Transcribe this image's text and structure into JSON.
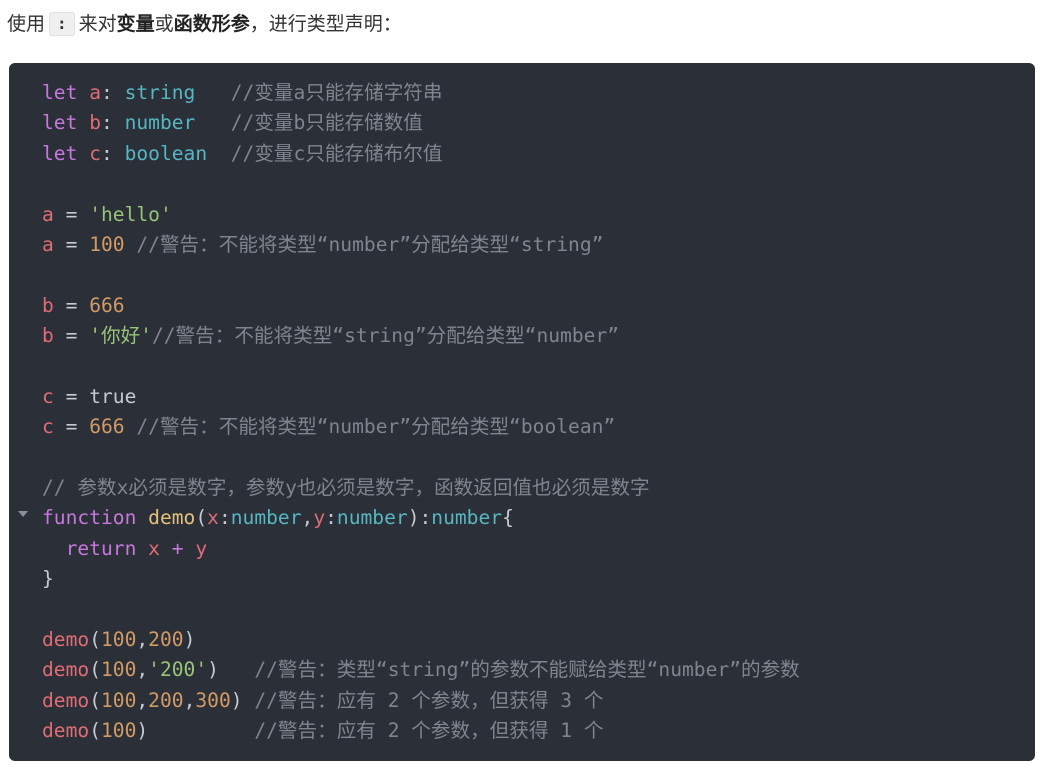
{
  "intro": {
    "prefix": "使用",
    "inline_code": ":",
    "middle": "来对",
    "bold1": "变量",
    "or": "或",
    "bold2": "函数形参",
    "suffix": "，进行类型声明："
  },
  "code": {
    "lines": [
      [
        [
          "kw",
          "let"
        ],
        [
          "pun",
          " "
        ],
        [
          "var",
          "a"
        ],
        [
          "pun",
          ": "
        ],
        [
          "type",
          "string"
        ],
        [
          "pun",
          "   "
        ],
        [
          "cmt",
          "//变量a只能存储字符串"
        ]
      ],
      [
        [
          "kw",
          "let"
        ],
        [
          "pun",
          " "
        ],
        [
          "var",
          "b"
        ],
        [
          "pun",
          ": "
        ],
        [
          "type",
          "number"
        ],
        [
          "pun",
          "   "
        ],
        [
          "cmt",
          "//变量b只能存储数值"
        ]
      ],
      [
        [
          "kw",
          "let"
        ],
        [
          "pun",
          " "
        ],
        [
          "var",
          "c"
        ],
        [
          "pun",
          ": "
        ],
        [
          "type",
          "boolean"
        ],
        [
          "pun",
          "  "
        ],
        [
          "cmt",
          "//变量c只能存储布尔值"
        ]
      ],
      [],
      [
        [
          "var",
          "a"
        ],
        [
          "pun",
          " = "
        ],
        [
          "str",
          "'hello'"
        ]
      ],
      [
        [
          "var",
          "a"
        ],
        [
          "pun",
          " = "
        ],
        [
          "num",
          "100"
        ],
        [
          "pun",
          " "
        ],
        [
          "cmt",
          "//警告：不能将类型“number”分配给类型“string”"
        ]
      ],
      [],
      [
        [
          "var",
          "b"
        ],
        [
          "pun",
          " = "
        ],
        [
          "num",
          "666"
        ]
      ],
      [
        [
          "var",
          "b"
        ],
        [
          "pun",
          " = "
        ],
        [
          "str",
          "'你好'"
        ],
        [
          "cmt",
          "//警告：不能将类型“string”分配给类型“number”"
        ]
      ],
      [],
      [
        [
          "var",
          "c"
        ],
        [
          "pun",
          " = "
        ],
        [
          "pun",
          "true"
        ]
      ],
      [
        [
          "var",
          "c"
        ],
        [
          "pun",
          " = "
        ],
        [
          "num",
          "666"
        ],
        [
          "pun",
          " "
        ],
        [
          "cmt",
          "//警告：不能将类型“number”分配给类型“boolean”"
        ]
      ],
      [],
      [
        [
          "cmt",
          "// 参数x必须是数字，参数y也必须是数字，函数返回值也必须是数字"
        ]
      ],
      [
        [
          "kw",
          "function"
        ],
        [
          "pun",
          " "
        ],
        [
          "fn",
          "demo"
        ],
        [
          "pun",
          "("
        ],
        [
          "var",
          "x"
        ],
        [
          "pun",
          ":"
        ],
        [
          "type",
          "number"
        ],
        [
          "pun",
          ","
        ],
        [
          "var",
          "y"
        ],
        [
          "pun",
          ":"
        ],
        [
          "type",
          "number"
        ],
        [
          "pun",
          "):"
        ],
        [
          "type",
          "number"
        ],
        [
          "pun",
          "{"
        ]
      ],
      [
        [
          "pun",
          "  "
        ],
        [
          "kw",
          "return"
        ],
        [
          "pun",
          " "
        ],
        [
          "var",
          "x"
        ],
        [
          "pun",
          " "
        ],
        [
          "kw",
          "+"
        ],
        [
          "pun",
          " "
        ],
        [
          "var",
          "y"
        ]
      ],
      [
        [
          "pun",
          "}"
        ]
      ],
      [],
      [
        [
          "var",
          "demo"
        ],
        [
          "pun",
          "("
        ],
        [
          "num",
          "100"
        ],
        [
          "pun",
          ","
        ],
        [
          "num",
          "200"
        ],
        [
          "pun",
          ")"
        ]
      ],
      [
        [
          "var",
          "demo"
        ],
        [
          "pun",
          "("
        ],
        [
          "num",
          "100"
        ],
        [
          "pun",
          ","
        ],
        [
          "str",
          "'200'"
        ],
        [
          "pun",
          ")   "
        ],
        [
          "cmt",
          "//警告：类型“string”的参数不能赋给类型“number”的参数"
        ]
      ],
      [
        [
          "var",
          "demo"
        ],
        [
          "pun",
          "("
        ],
        [
          "num",
          "100"
        ],
        [
          "pun",
          ","
        ],
        [
          "num",
          "200"
        ],
        [
          "pun",
          ","
        ],
        [
          "num",
          "300"
        ],
        [
          "pun",
          ") "
        ],
        [
          "cmt",
          "//警告：应有 2 个参数，但获得 3 个"
        ]
      ],
      [
        [
          "var",
          "demo"
        ],
        [
          "pun",
          "("
        ],
        [
          "num",
          "100"
        ],
        [
          "pun",
          ")         "
        ],
        [
          "cmt",
          "//警告：应有 2 个参数，但获得 1 个"
        ]
      ]
    ]
  }
}
